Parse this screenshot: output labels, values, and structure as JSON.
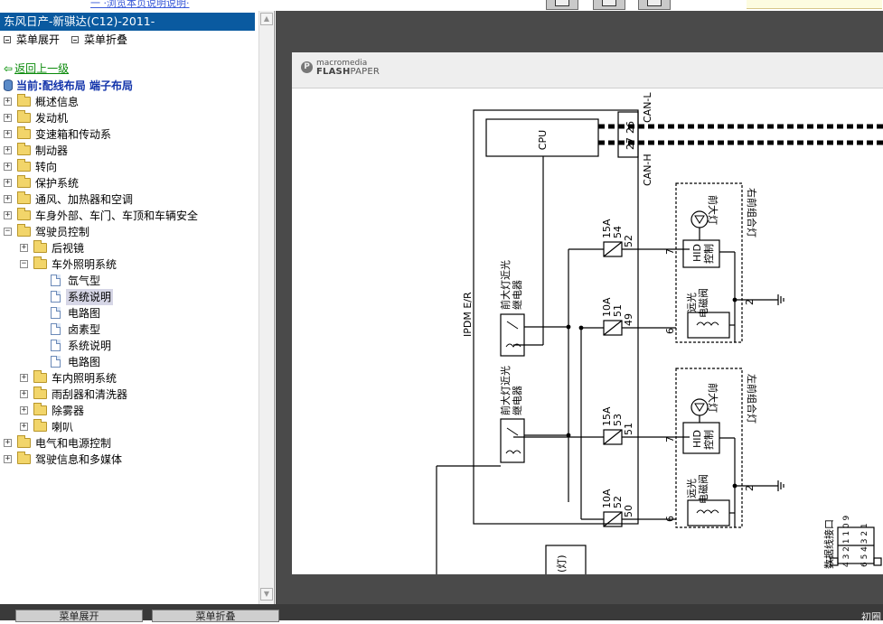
{
  "top": {
    "link_text": "一 ·浏览本页说明说明·"
  },
  "sidebar": {
    "title": "东风日产-新骐达(C12)-2011-",
    "expand_label": "菜单展开",
    "collapse_label": "菜单折叠",
    "back_label": "返回上一级",
    "current_label": "当前:配线布局  端子布局",
    "tree": [
      {
        "label": "概述信息",
        "depth": 0,
        "kind": "folder",
        "exp": "+"
      },
      {
        "label": "发动机",
        "depth": 0,
        "kind": "folder",
        "exp": "+"
      },
      {
        "label": "变速箱和传动系",
        "depth": 0,
        "kind": "folder",
        "exp": "+"
      },
      {
        "label": "制动器",
        "depth": 0,
        "kind": "folder",
        "exp": "+"
      },
      {
        "label": "转向",
        "depth": 0,
        "kind": "folder",
        "exp": "+"
      },
      {
        "label": "保护系统",
        "depth": 0,
        "kind": "folder",
        "exp": "+"
      },
      {
        "label": "通风、加热器和空调",
        "depth": 0,
        "kind": "folder",
        "exp": "+"
      },
      {
        "label": "车身外部、车门、车顶和车辆安全",
        "depth": 0,
        "kind": "folder",
        "exp": "+"
      },
      {
        "label": "驾驶员控制",
        "depth": 0,
        "kind": "folder",
        "exp": "-"
      },
      {
        "label": "后视镜",
        "depth": 1,
        "kind": "folder",
        "exp": "+"
      },
      {
        "label": "车外照明系统",
        "depth": 1,
        "kind": "folder",
        "exp": "-"
      },
      {
        "label": "氙气型",
        "depth": 2,
        "kind": "doc",
        "exp": ""
      },
      {
        "label": "系统说明",
        "depth": 2,
        "kind": "doc",
        "exp": "",
        "selected": true
      },
      {
        "label": "电路图",
        "depth": 2,
        "kind": "doc",
        "exp": ""
      },
      {
        "label": "卤素型",
        "depth": 2,
        "kind": "doc",
        "exp": ""
      },
      {
        "label": "系统说明",
        "depth": 2,
        "kind": "doc",
        "exp": ""
      },
      {
        "label": "电路图",
        "depth": 2,
        "kind": "doc",
        "exp": ""
      },
      {
        "label": "车内照明系统",
        "depth": 1,
        "kind": "folder",
        "exp": "+"
      },
      {
        "label": "雨刮器和清洗器",
        "depth": 1,
        "kind": "folder",
        "exp": "+"
      },
      {
        "label": "除雾器",
        "depth": 1,
        "kind": "folder",
        "exp": "+"
      },
      {
        "label": "喇叭",
        "depth": 1,
        "kind": "folder",
        "exp": "+"
      },
      {
        "label": "电气和电源控制",
        "depth": 0,
        "kind": "folder",
        "exp": "+"
      },
      {
        "label": "驾驶信息和多媒体",
        "depth": 0,
        "kind": "folder",
        "exp": "+"
      }
    ]
  },
  "viewer": {
    "logo_small": "macromedia",
    "logo_brand": "FLASH",
    "logo_brand2": "PAPER"
  },
  "diagram": {
    "cpu": "CPU",
    "can_l": "CAN-L",
    "can_h": "CAN-H",
    "pin_26": "26",
    "pin_27": "27",
    "ipdm": "IPDM E/R",
    "relay_a": "前大灯近光",
    "relay_b": "继电器",
    "fuse_15a": "15A",
    "fuse_10a": "10A",
    "f54": "54",
    "f51": "51",
    "f53": "53",
    "f52": "52",
    "p52": "52",
    "p49": "49",
    "p51": "51",
    "p50": "50",
    "p7": "7",
    "p6": "6",
    "p2": "2",
    "right_combo": "右前组合灯",
    "left_combo": "左前组合灯",
    "hid1": "HID",
    "hid2": "控制",
    "far1": "远光",
    "far2": "电磁阀",
    "headlamp": "前大灯",
    "data_conn": "数据线接口",
    "conn_top": "4 3 2 1 1 0 9",
    "conn_bot": "6 5 4 3 2 1",
    "bottom_box": "(灯)"
  },
  "bottombar": {
    "btn1": "菜单展开",
    "btn2": "菜单折叠",
    "right_text": "初圈"
  }
}
